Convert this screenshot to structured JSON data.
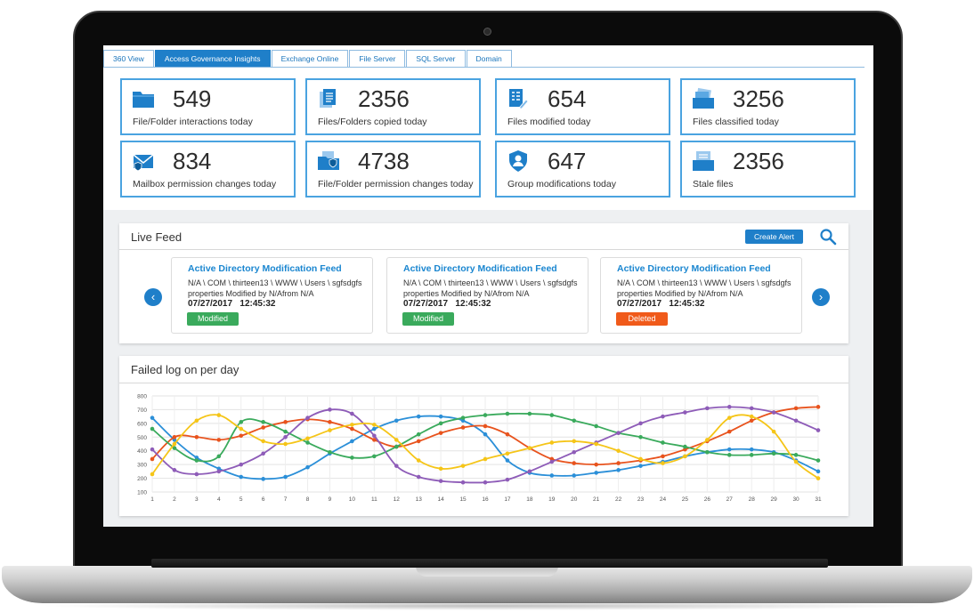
{
  "tabs": [
    {
      "label": "360 View",
      "active": false
    },
    {
      "label": "Access Governance Insights",
      "active": true
    },
    {
      "label": "Exchange Online",
      "active": false
    },
    {
      "label": "File Server",
      "active": false
    },
    {
      "label": "SQL Server",
      "active": false
    },
    {
      "label": "Domain",
      "active": false
    }
  ],
  "stats": [
    {
      "value": "549",
      "label": "File/Folder interactions today",
      "icon": "folder-icon"
    },
    {
      "value": "2356",
      "label": "Files/Folders copied today",
      "icon": "copy-files-icon"
    },
    {
      "value": "654",
      "label": "Files modified today",
      "icon": "edit-file-icon"
    },
    {
      "value": "3256",
      "label": "Files classified today",
      "icon": "classified-files-icon"
    },
    {
      "value": "834",
      "label": "Mailbox permission changes today",
      "icon": "mailbox-shield-icon"
    },
    {
      "value": "4738",
      "label": "File/Folder permission changes today",
      "icon": "folder-shield-icon"
    },
    {
      "value": "647",
      "label": "Group modifications today",
      "icon": "group-shield-icon"
    },
    {
      "value": "2356",
      "label": "Stale files",
      "icon": "stale-files-icon"
    }
  ],
  "live_feed": {
    "title": "Live Feed",
    "create_alert_label": "Create Alert",
    "prev_glyph": "‹",
    "next_glyph": "›",
    "items": [
      {
        "title": "Active Directory Modification Feed",
        "text": "N/A \\ COM \\ thirteen13 \\ WWW \\ Users \\ sgfsdgfs properties Modified by N/Afrom N/A",
        "date": "07/27/2017",
        "time": "12:45:32",
        "status": "Modified",
        "status_color": "#3aaa5c"
      },
      {
        "title": "Active Directory Modification Feed",
        "text": "N/A \\ COM \\ thirteen13 \\ WWW \\ Users \\ sgfsdgfs properties Modified by N/Afrom N/A",
        "date": "07/27/2017",
        "time": "12:45:32",
        "status": "Modified",
        "status_color": "#3aaa5c"
      },
      {
        "title": "Active Directory Modification Feed",
        "text": "N/A \\ COM \\ thirteen13 \\ WWW \\ Users \\ sgfsdgfs properties Modified by N/Afrom N/A",
        "date": "07/27/2017",
        "time": "12:45:32",
        "status": "Deleted",
        "status_color": "#f05a1a"
      }
    ]
  },
  "chart_panel": {
    "title": "Failed log on per day"
  },
  "chart_data": {
    "type": "line",
    "x": [
      1,
      2,
      3,
      4,
      5,
      6,
      7,
      8,
      9,
      10,
      11,
      12,
      13,
      14,
      15,
      16,
      17,
      18,
      19,
      20,
      21,
      22,
      23,
      24,
      25,
      26,
      27,
      28,
      29,
      30,
      31
    ],
    "ylim": [
      100,
      800
    ],
    "yticks": [
      100,
      200,
      300,
      400,
      500,
      600,
      700,
      800
    ],
    "grid": true,
    "series": [
      {
        "color": "#2b8fd8",
        "values": [
          640,
          480,
          350,
          270,
          210,
          195,
          210,
          280,
          380,
          470,
          560,
          620,
          650,
          650,
          620,
          520,
          330,
          240,
          220,
          220,
          240,
          260,
          290,
          320,
          360,
          390,
          410,
          410,
          390,
          330,
          250
        ]
      },
      {
        "color": "#e8531d",
        "values": [
          340,
          500,
          500,
          480,
          510,
          570,
          610,
          630,
          610,
          560,
          480,
          430,
          470,
          530,
          570,
          580,
          520,
          420,
          340,
          310,
          300,
          310,
          330,
          360,
          410,
          470,
          540,
          620,
          680,
          710,
          720
        ]
      },
      {
        "color": "#3aaa5c",
        "values": [
          560,
          420,
          330,
          360,
          610,
          610,
          540,
          460,
          390,
          350,
          360,
          430,
          520,
          600,
          640,
          660,
          670,
          670,
          660,
          620,
          580,
          530,
          500,
          460,
          430,
          390,
          370,
          370,
          380,
          370,
          330
        ]
      },
      {
        "color": "#8e5cb8",
        "values": [
          410,
          260,
          230,
          250,
          300,
          380,
          500,
          640,
          700,
          670,
          510,
          290,
          210,
          180,
          170,
          170,
          190,
          250,
          320,
          390,
          460,
          530,
          600,
          650,
          680,
          710,
          720,
          710,
          680,
          620,
          550
        ]
      },
      {
        "color": "#f5c518",
        "values": [
          230,
          450,
          620,
          660,
          560,
          470,
          450,
          490,
          550,
          590,
          590,
          480,
          330,
          270,
          290,
          340,
          380,
          420,
          460,
          470,
          450,
          400,
          340,
          310,
          360,
          480,
          640,
          650,
          540,
          320,
          200
        ]
      }
    ]
  }
}
